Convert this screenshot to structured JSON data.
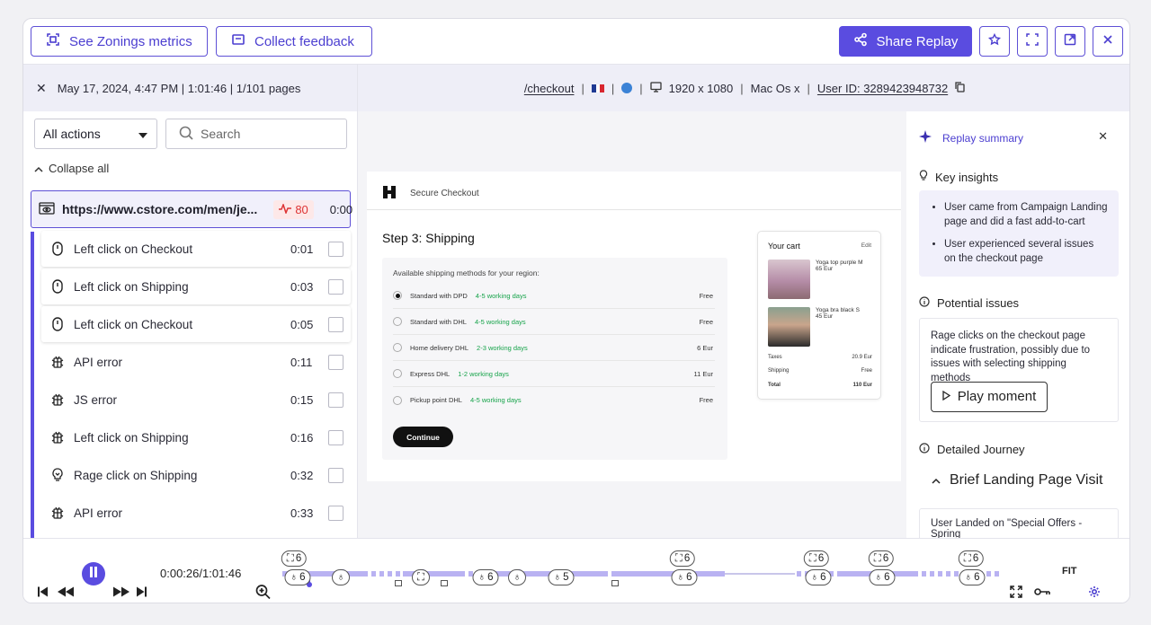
{
  "toolbar": {
    "zoning_label": "See Zonings metrics",
    "feedback_label": "Collect feedback",
    "share_label": "Share Replay"
  },
  "session": {
    "date": "May 17, 2024, 4:47 PM",
    "duration": "1:01:46",
    "pages": "1/101 pages",
    "path": "/checkout",
    "resolution": "1920 x 1080",
    "os": "Mac Os x",
    "user_id": "User ID: 3289423948732"
  },
  "filters": {
    "select_value": "All actions",
    "search_placeholder": "Search",
    "collapse_label": "Collapse all"
  },
  "url_row": {
    "url": "https://www.cstore.com/men/je...",
    "score": "80",
    "time": "0:00"
  },
  "events": [
    {
      "label": "Left click on Checkout",
      "time": "0:01",
      "icon": "mouse-icon"
    },
    {
      "label": "Left click on Shipping",
      "time": "0:03",
      "icon": "mouse-icon"
    },
    {
      "label": "Left click on Checkout",
      "time": "0:05",
      "icon": "mouse-icon"
    },
    {
      "label": "API error",
      "time": "0:11",
      "icon": "bug-icon"
    },
    {
      "label": "JS error",
      "time": "0:15",
      "icon": "bug-icon"
    },
    {
      "label": "Left click on Shipping",
      "time": "0:16",
      "icon": "bug-icon"
    },
    {
      "label": "Rage click on Shipping",
      "time": "0:32",
      "icon": "rage-icon"
    },
    {
      "label": "API error",
      "time": "0:33",
      "icon": "bug-icon"
    }
  ],
  "replay_page": {
    "header": "Secure Checkout",
    "step": "Step 3: Shipping",
    "intro": "Available shipping methods for your region:",
    "options": [
      {
        "name": "Standard with DPD",
        "days": "4-5 working days",
        "price": "Free",
        "selected": true
      },
      {
        "name": "Standard with DHL",
        "days": "4-5 working days",
        "price": "Free",
        "selected": false
      },
      {
        "name": "Home delivery DHL",
        "days": "2-3 working days",
        "price": "6 Eur",
        "selected": false
      },
      {
        "name": "Express DHL",
        "days": "1-2 working days",
        "price": "11 Eur",
        "selected": false
      },
      {
        "name": "Pickup point DHL",
        "days": "4-5 working days",
        "price": "Free",
        "selected": false
      }
    ],
    "continue": "Continue",
    "cart": {
      "title": "Your cart",
      "edit": "Edit",
      "items": [
        {
          "name": "Yoga top purple M",
          "price": "65 Eur"
        },
        {
          "name": "Yoga bra black S",
          "price": "45 Eur"
        }
      ],
      "taxes_label": "Taxes",
      "taxes_value": "20.9 Eur",
      "shipping_label": "Shipping",
      "shipping_value": "Free",
      "total_label": "Total",
      "total_value": "110 Eur"
    }
  },
  "summary": {
    "title": "Replay summary",
    "key_insights_title": "Key insights",
    "insights": [
      "User came from Campaign Landing page and did a fast add-to-cart",
      "User experienced several issues on the checkout page"
    ],
    "issues_title": "Potential issues",
    "issue_text": "Rage clicks on the checkout page indicate frustration, possibly due to issues with selecting shipping methods",
    "play_moment": "Play moment",
    "journey_title": "Detailed Journey",
    "brief": "Brief Landing Page Visit",
    "landed": "User Landed on \"Special Offers - Spring"
  },
  "player": {
    "time": "0:00:26/1:01:46",
    "fit": "FIT",
    "pills": {
      "p1": "6",
      "p2": "6",
      "p3": "6",
      "p4": "5",
      "p5": "6",
      "p6": "6",
      "p7": "6",
      "p8": "6",
      "p9": "6",
      "p10": "6",
      "p11": "6",
      "p12": "6"
    }
  },
  "colors": {
    "accent": "#5a4ce0",
    "error": "#d33333",
    "success": "#16a34a"
  }
}
